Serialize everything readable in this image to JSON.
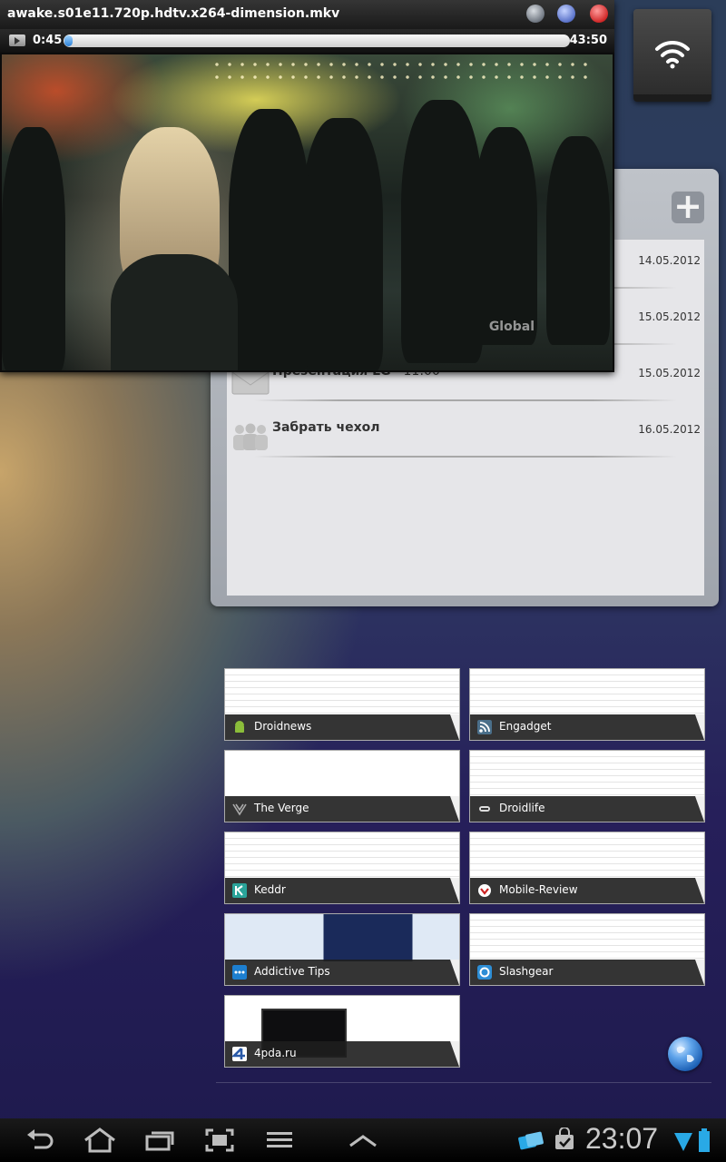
{
  "player": {
    "title": "awake.s01e11.720p.hdtv.x264-dimension.mkv",
    "current_time": "0:45",
    "total_time": "43:50",
    "progress": 0.017,
    "video_logo": "Global"
  },
  "calendar": {
    "add_label": "+",
    "events": [
      {
        "title": "",
        "time": "",
        "date": "14.05.2012",
        "icon": "envelope-icon"
      },
      {
        "title": "",
        "time": "",
        "date": "15.05.2012",
        "icon": "envelope-icon"
      },
      {
        "title": "Презентация LG",
        "time": " - 11:00",
        "date": "15.05.2012",
        "icon": "envelope-icon"
      },
      {
        "title": "Забрать чехол",
        "time": "",
        "date": "16.05.2012",
        "icon": "people-icon"
      }
    ]
  },
  "bookmarks": [
    {
      "name": "Droidnews",
      "icon": "android-icon",
      "color": "#8bbd3a"
    },
    {
      "name": "Engadget",
      "icon": "rss-icon",
      "color": "#4a6f8a"
    },
    {
      "name": "The Verge",
      "icon": "verge-icon",
      "color": "#555555"
    },
    {
      "name": "Droidlife",
      "icon": "droidlife-icon",
      "color": "#2f2f2f"
    },
    {
      "name": "Keddr",
      "icon": "keddr-icon",
      "color": "#2aa39a"
    },
    {
      "name": "Mobile-Review",
      "icon": "mobile-review-icon",
      "color": "#cc2222"
    },
    {
      "name": "Addictive Tips",
      "icon": "addictive-tips-icon",
      "color": "#1d7fd0"
    },
    {
      "name": "Slashgear",
      "icon": "slashgear-icon",
      "color": "#2d8ed6"
    },
    {
      "name": "4pda.ru",
      "icon": "4pda-icon",
      "color": "#2a5aa8"
    }
  ],
  "statusbar": {
    "clock": "23:07",
    "colors": {
      "accent": "#29a9e6"
    }
  }
}
